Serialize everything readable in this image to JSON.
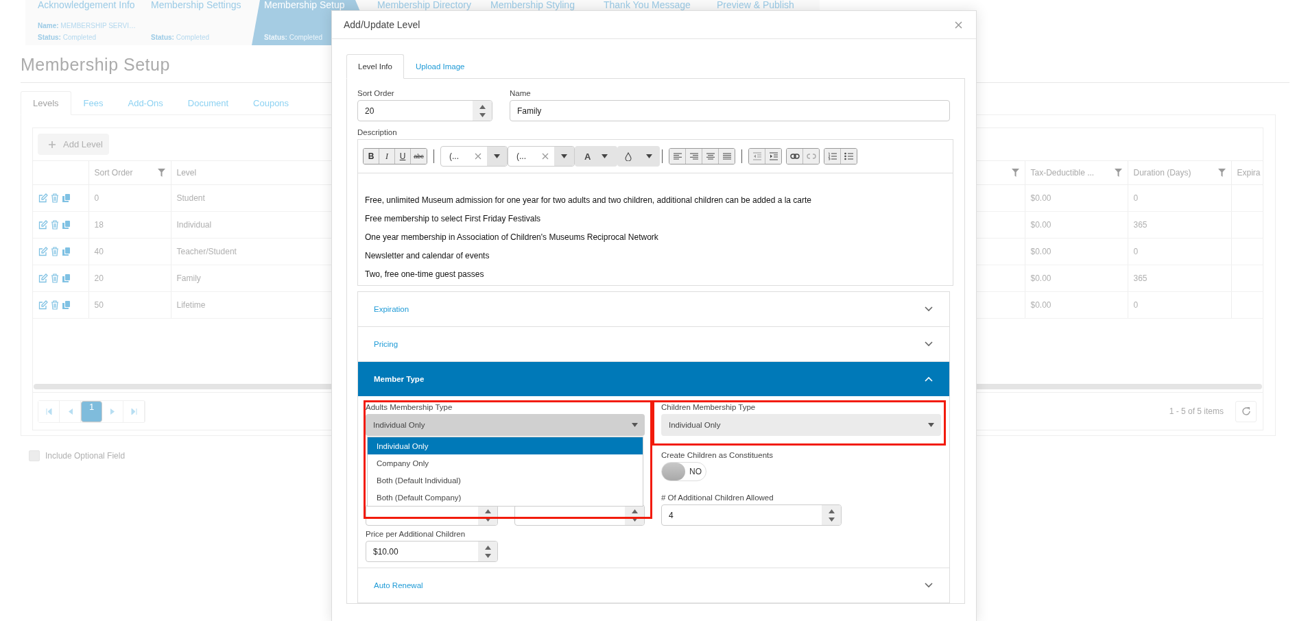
{
  "stepper": [
    {
      "title": "Acknowledgement Info",
      "name_line": "**Name:** MEMBERSHIP SERVI…",
      "status_line": "**Status:** Completed",
      "selected": false
    },
    {
      "title": "Membership Settings",
      "status_line": "**Status:** Completed",
      "selected": false
    },
    {
      "title": "Membership Setup",
      "status_line": "**Status:** Completed",
      "selected": true
    },
    {
      "title": "Membership Directory",
      "selected": false
    },
    {
      "title": "Membership Styling",
      "selected": false
    },
    {
      "title": "Thank You Message",
      "selected": false
    },
    {
      "title": "Preview & Publish",
      "selected": false
    }
  ],
  "page": {
    "title": "Membership Setup",
    "tabs": [
      {
        "label": "Levels",
        "selected": true
      },
      {
        "label": "Fees",
        "selected": false
      },
      {
        "label": "Add-Ons",
        "selected": false
      },
      {
        "label": "Document",
        "selected": false
      },
      {
        "label": "Coupons",
        "selected": false
      }
    ],
    "grid": {
      "add_button": "Add Level",
      "columns": [
        {
          "label": "Sort Order",
          "filter": true
        },
        {
          "label": "Level",
          "filter": true
        },
        {
          "label": "Tax-Deductible ...",
          "filter": true
        },
        {
          "label": "Duration (Days)",
          "filter": true
        },
        {
          "label": "Expira",
          "filter": false
        }
      ],
      "rows": [
        {
          "sort_order": "0",
          "level": "Student",
          "tax_deductible": "$0.00",
          "duration": "0"
        },
        {
          "sort_order": "18",
          "level": "Individual",
          "tax_deductible": "$0.00",
          "duration": "365"
        },
        {
          "sort_order": "40",
          "level": "Teacher/Student",
          "tax_deductible": "$0.00",
          "duration": "0"
        },
        {
          "sort_order": "20",
          "level": "Family",
          "tax_deductible": "$0.00",
          "duration": "365"
        },
        {
          "sort_order": "50",
          "level": "Lifetime",
          "tax_deductible": "$0.00",
          "duration": "0"
        }
      ],
      "pages": [
        {
          "label": "1",
          "selected": true
        }
      ],
      "summary": "1 - 5 of 5 items"
    },
    "include_optional": {
      "label": "Include Optional Field",
      "checked": false
    }
  },
  "modal": {
    "title": "Add/Update Level",
    "tabs": [
      {
        "label": "Level Info",
        "selected": true
      },
      {
        "label": "Upload Image",
        "selected": false
      }
    ],
    "sort_order": {
      "label": "Sort Order",
      "value": "20"
    },
    "name": {
      "label": "Name",
      "value": "Family"
    },
    "description": {
      "label": "Description",
      "toolbar": {
        "format_buttons": [
          "B",
          "I",
          "U",
          "abc"
        ],
        "font_name": "(...",
        "font_size": "(...",
        "text_color": "A"
      },
      "lines": [
        "Free, unlimited Museum admission for one year for two adults and two children, additional children can be added a la carte",
        "Free membership to select First Friday Festivals",
        "One year membership in Association of Children's Museums Reciprocal Network",
        "Newsletter and calendar of events",
        "Two, free one-time guest passes"
      ]
    },
    "sections": [
      {
        "title": "Expiration",
        "expanded": false
      },
      {
        "title": "Pricing",
        "expanded": false
      },
      {
        "title": "Member Type",
        "expanded": true,
        "content": {
          "adults": {
            "label": "Adults Membership Type",
            "value": "Individual Only",
            "open": true,
            "options": [
              {
                "label": "Individual Only",
                "selected": true
              },
              {
                "label": "Company Only",
                "selected": false
              },
              {
                "label": "Both (Default Individual)",
                "selected": false
              },
              {
                "label": "Both (Default Company)",
                "selected": false
              }
            ]
          },
          "children": {
            "label": "Children Membership Type",
            "value": "Individual Only"
          },
          "create_children": {
            "label": "Create Children as Constituents",
            "on": false,
            "state_text": "NO"
          },
          "additional_children": {
            "label": "# Of Additional Children Allowed",
            "value": "4"
          },
          "price_per_additional": {
            "label": "Price per Additional Children",
            "value": "$10.00"
          }
        }
      },
      {
        "title": "Auto Renewal",
        "expanded": false
      }
    ]
  }
}
